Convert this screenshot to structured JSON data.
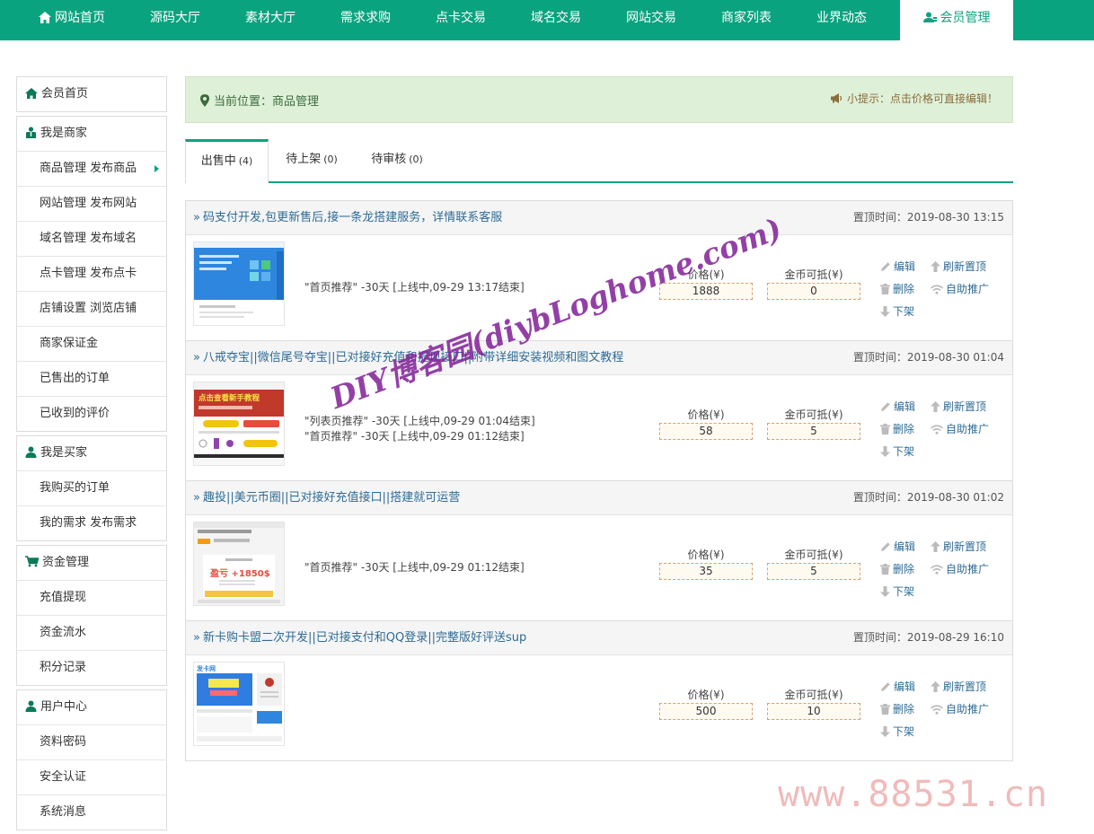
{
  "nav": {
    "items": [
      {
        "label": "网站首页",
        "icon": "home-icon"
      },
      {
        "label": "源码大厅"
      },
      {
        "label": "素材大厅"
      },
      {
        "label": "需求求购"
      },
      {
        "label": "点卡交易"
      },
      {
        "label": "域名交易"
      },
      {
        "label": "网站交易"
      },
      {
        "label": "商家列表"
      },
      {
        "label": "业界动态"
      },
      {
        "label": "会员管理",
        "icon": "user-manage-icon",
        "active": true
      }
    ]
  },
  "sidebar": {
    "home": "会员首页",
    "merchant": {
      "title": "我是商家",
      "items": [
        "商品管理 发布商品",
        "网站管理 发布网站",
        "域名管理 发布域名",
        "点卡管理 发布点卡",
        "店铺设置 浏览店铺",
        "商家保证金",
        "已售出的订单",
        "已收到的评价"
      ]
    },
    "buyer": {
      "title": "我是买家",
      "items": [
        "我购买的订单",
        "我的需求 发布需求"
      ]
    },
    "funds": {
      "title": "资金管理",
      "items": [
        "充值提现",
        "资金流水",
        "积分记录"
      ]
    },
    "user": {
      "title": "用户中心",
      "items": [
        "资料密码",
        "安全认证",
        "系统消息"
      ]
    }
  },
  "breadcrumb": {
    "label": "当前位置：商品管理",
    "tip": "小提示：点击价格可直接编辑！"
  },
  "tabs": [
    {
      "label": "出售中",
      "count": "(4)",
      "active": true
    },
    {
      "label": "待上架",
      "count": "(0)"
    },
    {
      "label": "待审核",
      "count": "(0)"
    }
  ],
  "labels": {
    "price": "价格(¥)",
    "coin": "金币可抵(¥)",
    "edit": "编辑",
    "refresh": "刷新置顶",
    "delete": "删除",
    "promote": "自助推广",
    "offline": "下架",
    "raquo": "»"
  },
  "products": [
    {
      "title": "码支付开发,包更新售后,接一条龙搭建服务，详情联系客服",
      "time": "置顶时间：2019-08-30 13:15",
      "promos": [
        "\"首页推荐\" -30天 [上线中,09-29 13:17结束]"
      ],
      "price": "1888",
      "coin": "0"
    },
    {
      "title": "八戒夺宝||微信尾号夺宝||已对接好充值和提现接口||附带详细安装视频和图文教程",
      "time": "置顶时间：2019-08-30 01:04",
      "promos": [
        "\"列表页推荐\" -30天 [上线中,09-29 01:04结束]",
        "\"首页推荐\" -30天 [上线中,09-29 01:12结束]"
      ],
      "price": "58",
      "coin": "5"
    },
    {
      "title": "趣投||美元币圈||已对接好充值接口||搭建就可运营",
      "time": "置顶时间：2019-08-30 01:02",
      "promos": [
        "\"首页推荐\" -30天 [上线中,09-29 01:12结束]"
      ],
      "price": "35",
      "coin": "5"
    },
    {
      "title": "新卡购卡盟二次开发||已对接支付和QQ登录||完整版好评送sup",
      "time": "置顶时间：2019-08-29 16:10",
      "promos": [],
      "price": "500",
      "coin": "10"
    }
  ],
  "thumbs": {
    "t2_line1": "点击查看新手教程",
    "t3_profit": "盈亏 +1850$",
    "t4_logo": "发卡网"
  },
  "watermarks": {
    "diag": "DIY博客园(diybLoghome.com)",
    "site": "www.88531.cn"
  }
}
